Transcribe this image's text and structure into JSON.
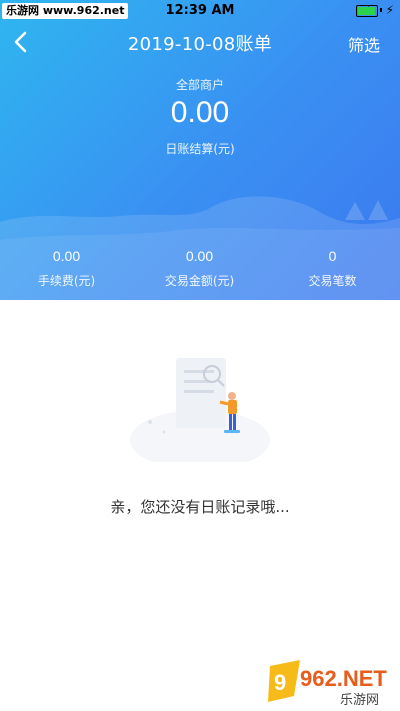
{
  "status_bar": {
    "left_text": "乐游网 www.962.net",
    "time": "12:39 AM"
  },
  "nav": {
    "title": "2019-10-08账单",
    "filter_label": "筛选"
  },
  "summary": {
    "merchant_label": "全部商户",
    "amount": "0.00",
    "amount_label": "日账结算(元)"
  },
  "stats": [
    {
      "value": "0.00",
      "label": "手续费(元)"
    },
    {
      "value": "0.00",
      "label": "交易金额(元)"
    },
    {
      "value": "0",
      "label": "交易笔数"
    }
  ],
  "empty_state": {
    "message": "亲，您还没有日账记录哦..."
  },
  "watermark": {
    "brand": "962.NET",
    "sub": "乐游网"
  },
  "colors": {
    "header_start": "#2fb6f0",
    "header_end": "#3c78ef",
    "battery": "#2bd24b"
  },
  "icons": [
    "chevron-left-icon",
    "battery-icon",
    "signal-icon",
    "empty-illustration"
  ]
}
